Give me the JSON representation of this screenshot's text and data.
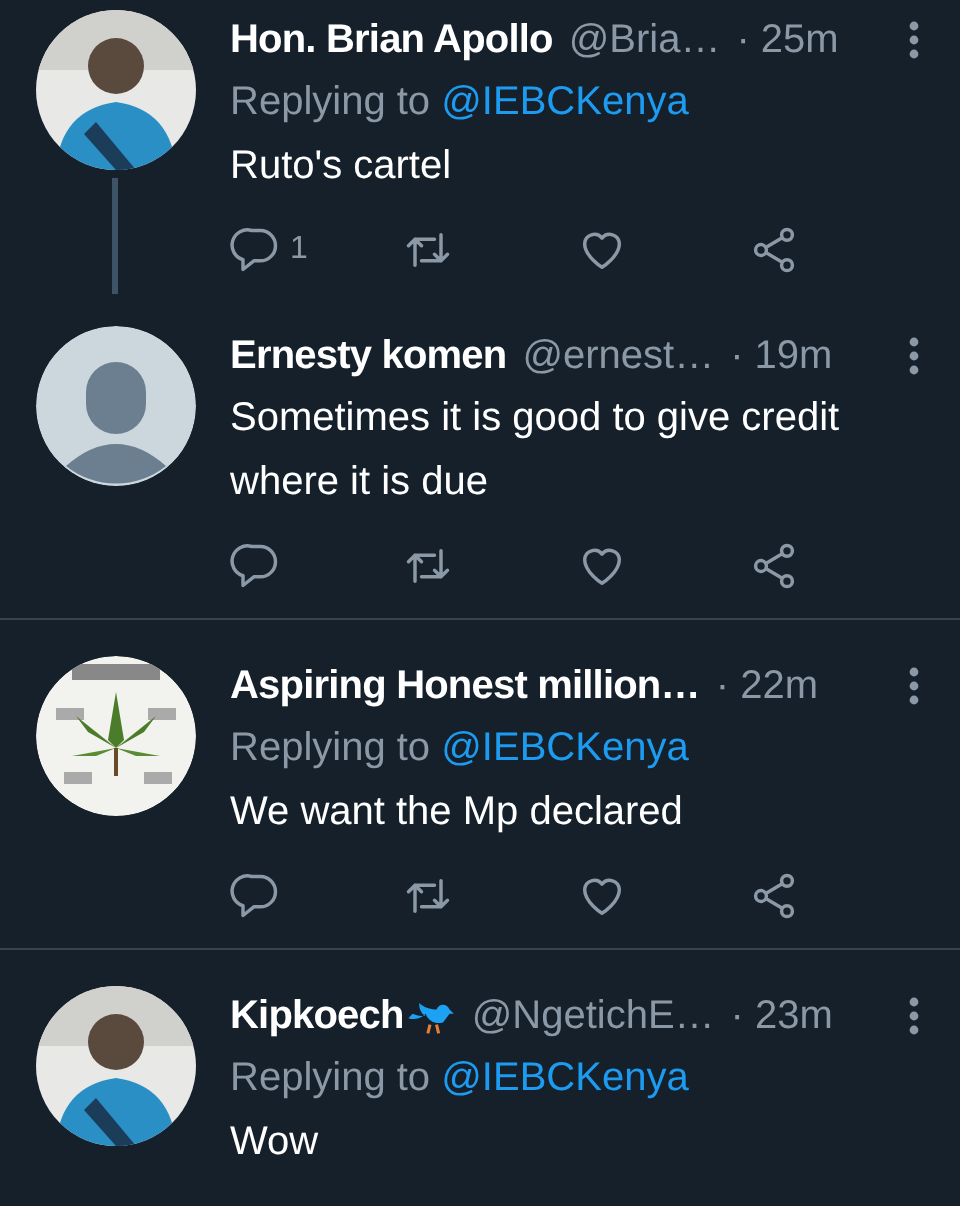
{
  "tweets": [
    {
      "name": "Hon. Brian Apollo",
      "name_icon": false,
      "handle": "@Bria…",
      "time": "· 25m",
      "replying_to": "Replying to",
      "reply_handle": "@IEBCKenya",
      "text": "Ruto's cartel",
      "actions": true,
      "reply_count": "1",
      "thread_line": true,
      "divider": false
    },
    {
      "avatar": {
        "kind": "default"
      },
      "name": "Ernesty komen",
      "name_icon": false,
      "handle": "@ernest…",
      "time": "· 19m",
      "text": "Sometimes it is good to give credit where it is due",
      "actions": true,
      "thread_line": false,
      "divider": true
    },
    {
      "name": "Aspiring Honest million…",
      "name_icon": false,
      "time": "· 22m",
      "replying_to": "Replying to",
      "reply_handle": "@IEBCKenya",
      "text": "We want the Mp declared",
      "actions": true,
      "thread_line": false,
      "divider": true
    },
    {
      "name": "Kipkoech",
      "name_icon": true,
      "handle": "@NgetichE…",
      "time": "· 23m",
      "replying_to": "Replying to",
      "reply_handle": "@IEBCKenya",
      "text": "Wow",
      "actions": false,
      "thread_line": false,
      "divider": false
    }
  ]
}
